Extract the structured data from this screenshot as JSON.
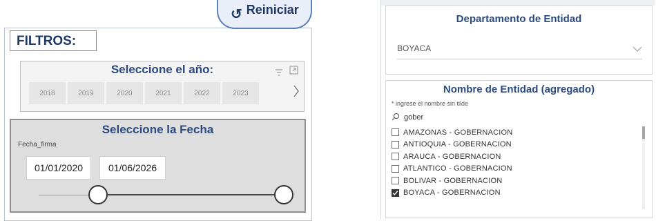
{
  "left_panel": {
    "reset_button_label": "Reiniciar",
    "filters_label": "FILTROS:",
    "year_slicer": {
      "title": "Seleccione el año:",
      "years": [
        "2018",
        "2019",
        "2020",
        "2021",
        "2022",
        "2023"
      ]
    },
    "date_slicer": {
      "title": "Seleccione la Fecha",
      "field_label": "Fecha_firma",
      "start_date": "01/01/2020",
      "end_date": "01/06/2026"
    }
  },
  "right_panel": {
    "department_slicer": {
      "title": "Departamento de Entidad",
      "selected": "BOYACA"
    },
    "entity_slicer": {
      "title": "Nombre de Entidad (agregado)",
      "hint": "* ingrese el nombre sin tilde",
      "search_value": "gober",
      "items": [
        {
          "label": "AMAZONAS - GOBERNACION",
          "checked": false
        },
        {
          "label": "ANTIOQUIA - GOBERNACION",
          "checked": false
        },
        {
          "label": "ARAUCA - GOBERNACION",
          "checked": false
        },
        {
          "label": "ATLANTICO - GOBERNACION",
          "checked": false
        },
        {
          "label": "BOLIVAR - GOBERNACION",
          "checked": false
        },
        {
          "label": "BOYACA - GOBERNACION",
          "checked": true
        }
      ]
    }
  }
}
